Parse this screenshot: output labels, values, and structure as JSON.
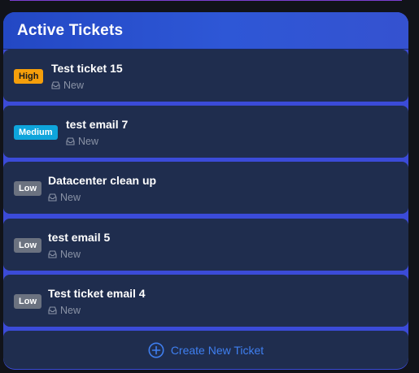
{
  "panel": {
    "title": "Active Tickets"
  },
  "tickets": [
    {
      "priority": "High",
      "title": "Test ticket 15",
      "status": "New"
    },
    {
      "priority": "Medium",
      "title": "test email 7",
      "status": "New"
    },
    {
      "priority": "Low",
      "title": "Datacenter clean up",
      "status": "New"
    },
    {
      "priority": "Low",
      "title": "test email 5",
      "status": "New"
    },
    {
      "priority": "Low",
      "title": "Test ticket email 4",
      "status": "New"
    }
  ],
  "create_button": {
    "label": "Create New Ticket",
    "icon": "plus-circle-icon"
  },
  "colors": {
    "high": "#f59f0b",
    "medium": "#0ea5dc",
    "low": "#6b7280",
    "accent": "#3f7ff0",
    "header": "#2e57d6"
  }
}
